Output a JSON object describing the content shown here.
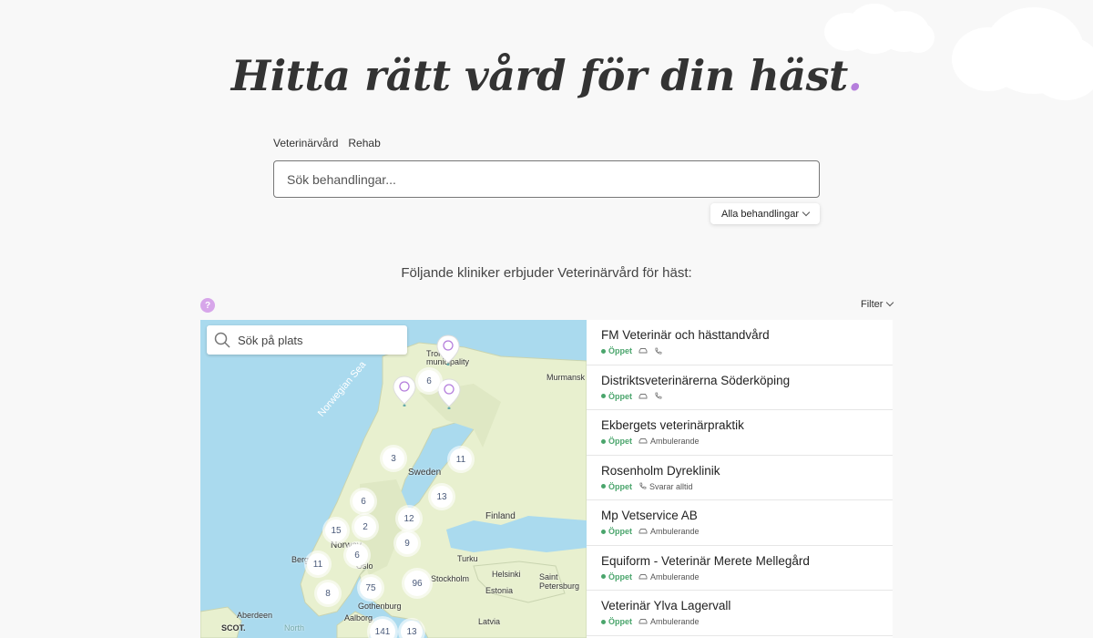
{
  "hero": {
    "title": "Hitta rätt vård för din häst",
    "dot": "."
  },
  "tabs": [
    "Veterinärvård",
    "Rehab"
  ],
  "search": {
    "placeholder": "Sök behandlingar..."
  },
  "dropdown": {
    "label": "Alla behandlingar"
  },
  "subtitle": "Följande kliniker erbjuder Veterinärvård för häst:",
  "help": "?",
  "filter": "Filter",
  "map": {
    "search_placeholder": "Sök på plats",
    "labels": [
      "Sweden",
      "Finland",
      "Norway",
      "Oslo",
      "Bergen",
      "Stockholm",
      "Helsinki",
      "Turku",
      "Saint Petersburg",
      "Estonia",
      "Latvia",
      "Gothenburg",
      "Aalborg",
      "Aberdeen",
      "SCOT.",
      "Murmansk",
      "Tromsø municipality",
      "North",
      "Norwegian Sea"
    ],
    "clusters": [
      "6",
      "3",
      "11",
      "6",
      "13",
      "12",
      "15",
      "2",
      "9",
      "6",
      "11",
      "96",
      "75",
      "8",
      "141",
      "13"
    ]
  },
  "clinics": [
    {
      "name": "FM Veterinär och hästtandvård",
      "status": "Öppet",
      "extra": ""
    },
    {
      "name": "Distriktsveterinärerna Söderköping",
      "status": "Öppet",
      "extra": ""
    },
    {
      "name": "Ekbergets veterinärpraktik",
      "status": "Öppet",
      "extra": "Ambulerande"
    },
    {
      "name": "Rosenholm Dyreklinik",
      "status": "Öppet",
      "extra": "Svarar alltid"
    },
    {
      "name": "Mp Vetservice AB",
      "status": "Öppet",
      "extra": "Ambulerande"
    },
    {
      "name": "Equiform - Veterinär Merete Mellegård",
      "status": "Öppet",
      "extra": "Ambulerande"
    },
    {
      "name": "Veterinär Ylva Lagervall",
      "status": "Öppet",
      "extra": "Ambulerande"
    }
  ],
  "colors": {
    "accent": "#b57edc",
    "open": "#4aa56c",
    "water": "#aadaee",
    "land": "#e8f0cf"
  }
}
